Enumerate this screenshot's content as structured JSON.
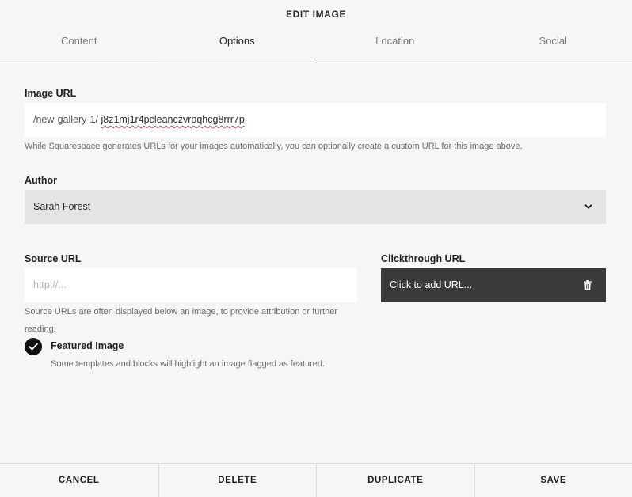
{
  "header": {
    "title": "EDIT IMAGE"
  },
  "tabs": [
    {
      "label": "Content"
    },
    {
      "label": "Options"
    },
    {
      "label": "Location"
    },
    {
      "label": "Social"
    }
  ],
  "active_tab": "Options",
  "image_url": {
    "label": "Image URL",
    "prefix": "/new-gallery-1/",
    "value": "j8z1mj1r4pcleanczvroqhcg8rrr7p",
    "help": "While Squarespace generates URLs for your images automatically, you can optionally create a custom URL for this image above."
  },
  "author": {
    "label": "Author",
    "value": "Sarah Forest"
  },
  "source_url": {
    "label": "Source URL",
    "placeholder": "http://...",
    "help_line1": "Source URLs are often displayed below an image, to provide attribution or further",
    "help_line2": "reading."
  },
  "clickthrough_url": {
    "label": "Clickthrough URL",
    "value": "Click to add URL..."
  },
  "featured": {
    "label": "Featured Image",
    "checked": true,
    "help": "Some templates and blocks will highlight an image flagged as featured."
  },
  "footer": {
    "cancel": "CANCEL",
    "delete": "DELETE",
    "duplicate": "DUPLICATE",
    "save": "SAVE"
  }
}
